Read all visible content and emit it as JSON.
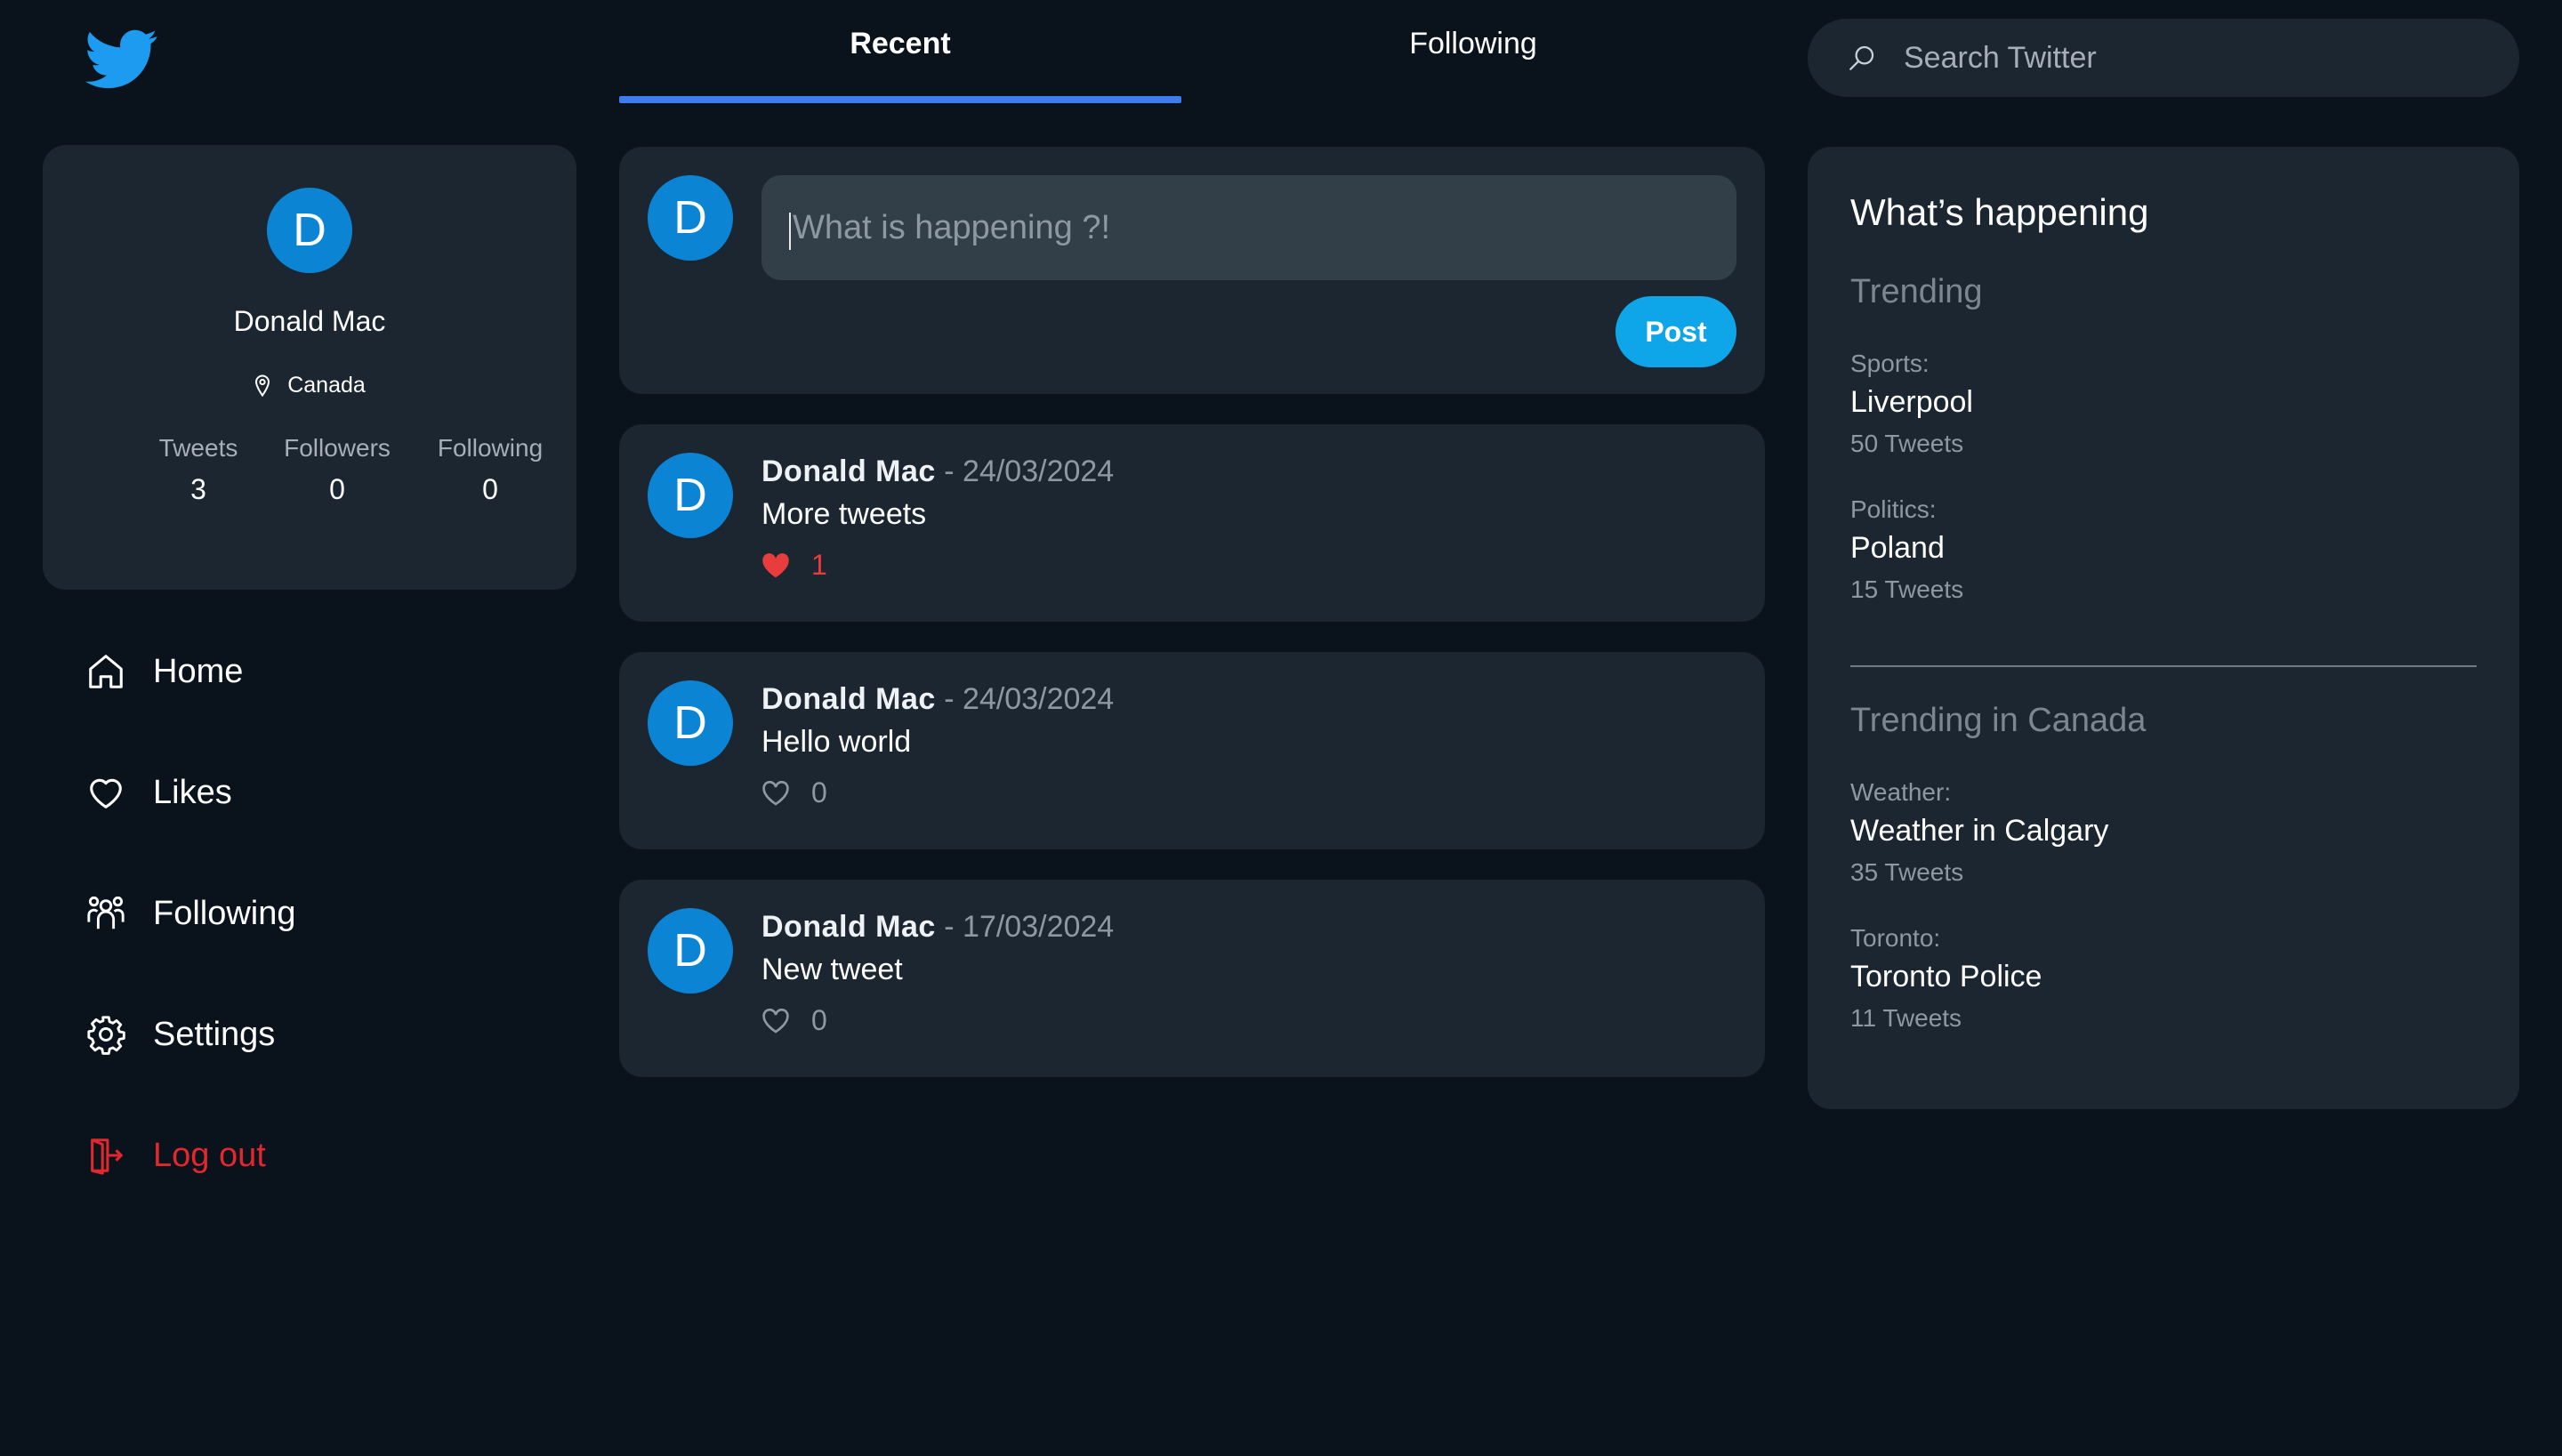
{
  "colors": {
    "background": "#0a121c",
    "card": "#1b2631",
    "accent": "#0ea5e9",
    "tab_underline": "#3e7df0",
    "avatar": "#0a84d3",
    "like_active": "#e93c3c",
    "logout": "#e0282e"
  },
  "logo": {
    "icon": "twitter-bird-icon"
  },
  "profile": {
    "avatar_letter": "D",
    "name": "Donald Mac",
    "location": "Canada",
    "stats": [
      {
        "label": "Tweets",
        "value": "3"
      },
      {
        "label": "Followers",
        "value": "0"
      },
      {
        "label": "Following",
        "value": "0"
      }
    ]
  },
  "nav": [
    {
      "label": "Home",
      "icon": "home-icon"
    },
    {
      "label": "Likes",
      "icon": "heart-icon"
    },
    {
      "label": "Following",
      "icon": "people-icon"
    },
    {
      "label": "Settings",
      "icon": "gear-icon"
    },
    {
      "label": "Log out",
      "icon": "logout-icon"
    }
  ],
  "tabs": [
    {
      "label": "Recent",
      "active": true
    },
    {
      "label": "Following",
      "active": false
    }
  ],
  "search": {
    "placeholder": "Search Twitter",
    "icon": "search-icon"
  },
  "composer": {
    "avatar_letter": "D",
    "placeholder": "What is happening ?!",
    "post_label": "Post"
  },
  "tweets": [
    {
      "avatar_letter": "D",
      "author": "Donald Mac",
      "separator": "- ",
      "date": "24/03/2024",
      "text": "More tweets",
      "likes": "1",
      "liked": true
    },
    {
      "avatar_letter": "D",
      "author": "Donald Mac",
      "separator": "- ",
      "date": "24/03/2024",
      "text": "Hello world",
      "likes": "0",
      "liked": false
    },
    {
      "avatar_letter": "D",
      "author": "Donald Mac",
      "separator": "- ",
      "date": "17/03/2024",
      "text": "New tweet",
      "likes": "0",
      "liked": false
    }
  ],
  "trends": {
    "title": "What’s happening",
    "sections": [
      {
        "heading": "Trending",
        "items": [
          {
            "category": "Sports:",
            "topic": "Liverpool",
            "count": "50 Tweets"
          },
          {
            "category": "Politics:",
            "topic": "Poland",
            "count": "15 Tweets"
          }
        ]
      },
      {
        "heading": "Trending in Canada",
        "items": [
          {
            "category": "Weather:",
            "topic": "Weather in Calgary",
            "count": "35 Tweets"
          },
          {
            "category": "Toronto:",
            "topic": "Toronto Police",
            "count": "11 Tweets"
          }
        ]
      }
    ]
  }
}
